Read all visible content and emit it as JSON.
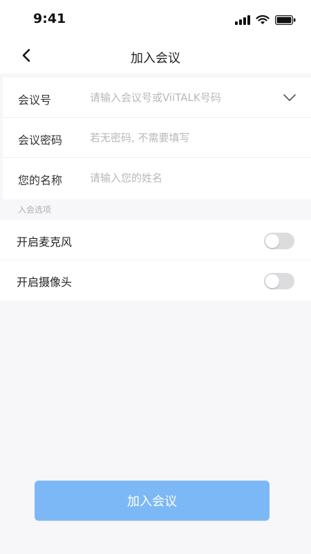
{
  "status_bar": {
    "time": "9:41"
  },
  "nav": {
    "title": "加入会议"
  },
  "form": {
    "meeting_id": {
      "label": "会议号",
      "placeholder": "请输入会议号或ViiTALK号码",
      "value": ""
    },
    "password": {
      "label": "会议密码",
      "placeholder": "若无密码, 不需要填写",
      "value": ""
    },
    "name": {
      "label": "您的名称",
      "placeholder": "请输入您的姓名",
      "value": ""
    }
  },
  "options": {
    "title": "入会选项",
    "microphone": {
      "label": "开启麦克风",
      "enabled": false
    },
    "camera": {
      "label": "开启摄像头",
      "enabled": false
    }
  },
  "join_button": {
    "label": "加入会议"
  },
  "colors": {
    "accent_button": "#7db8f6",
    "toggle_off": "#dcdcdf",
    "background": "#f7f6f8"
  }
}
